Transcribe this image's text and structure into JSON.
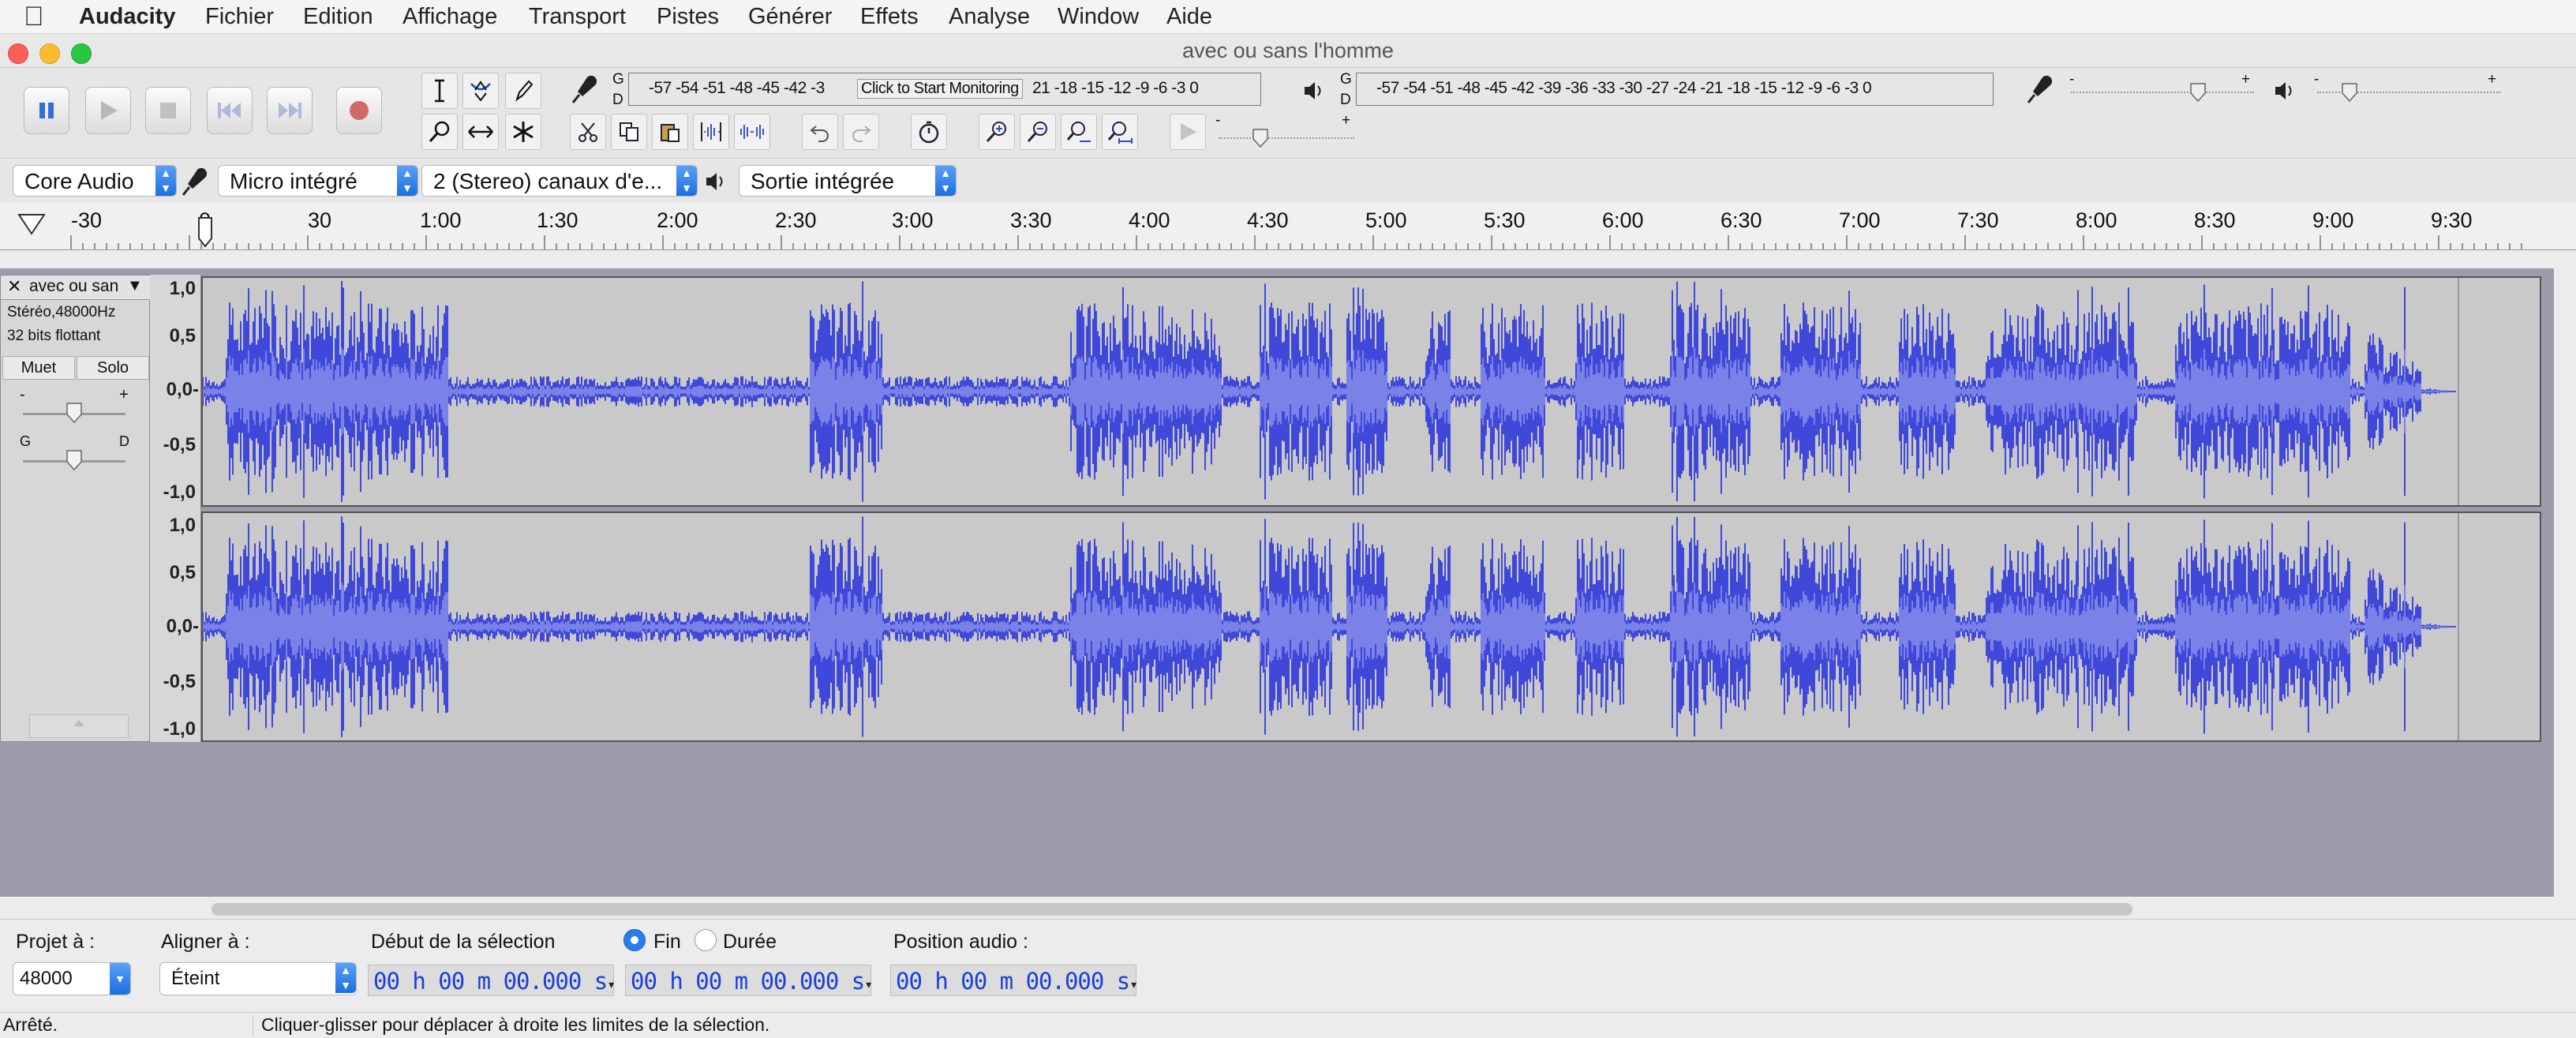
{
  "menubar": {
    "apple": "",
    "app_name": "Audacity",
    "items": [
      "Fichier",
      "Edition",
      "Affichage",
      "Transport",
      "Pistes",
      "Générer",
      "Effets",
      "Analyse",
      "Window",
      "Aide"
    ]
  },
  "window": {
    "title": "avec ou sans l'homme"
  },
  "meters": {
    "gd_g": "G",
    "gd_d": "D",
    "record_scale": "-57 -54 -51 -48 -45 -42 -3",
    "record_scale_tail": "21 -18 -15 -12 -9 -6 -3 0",
    "click_to_monitor": "Click to Start Monitoring",
    "play_scale": "-57 -54 -51 -48 -45 -42 -39 -36 -33 -30 -27 -24 -21 -18 -15 -12 -9 -6 -3 0",
    "minus": "-",
    "plus": "+"
  },
  "devices": {
    "host": "Core Audio",
    "input": "Micro intégré",
    "channels": "2 (Stereo) canaux d'e...",
    "output": "Sortie intégrée"
  },
  "ruler": {
    "labels": [
      "-30",
      "0",
      "30",
      "1:00",
      "1:30",
      "2:00",
      "2:30",
      "3:00",
      "3:30",
      "4:00",
      "4:30",
      "5:00",
      "5:30",
      "6:00",
      "6:30",
      "7:00",
      "7:30",
      "8:00",
      "8:30",
      "9:00",
      "9:30"
    ]
  },
  "track": {
    "name": "avec ou san",
    "format": "Stéréo,48000Hz",
    "bits": "32 bits flottant",
    "mute": "Muet",
    "solo": "Solo",
    "gain_minus": "-",
    "gain_plus": "+",
    "pan_left": "G",
    "pan_right": "D",
    "close": "✕",
    "menu_arrow": "▼",
    "vscale": [
      "1,0",
      "0,5",
      "0,0-",
      "-0,5",
      "-1,0"
    ]
  },
  "selection": {
    "project_rate_label": "Projet à :",
    "project_rate": "48000",
    "snap_label": "Aligner à :",
    "snap_value": "Éteint",
    "start_label": "Début de la sélection",
    "end_option": "Fin",
    "length_option": "Durée",
    "end_selected": true,
    "audio_pos_label": "Position audio :",
    "start_time": "00 h 00 m 00.000 s",
    "end_time": "00 h 00 m 00.000 s",
    "audio_time": "00 h 00 m 00.000 s"
  },
  "status": {
    "state": "Arrêté.",
    "hint": "Cliquer-glisser pour déplacer à droite les limites de la sélection."
  },
  "colors": {
    "wave": "#3f48d8",
    "wave_rms": "#7a82e8",
    "track_bg": "#9b9baa",
    "accent": "#2a7cf0"
  }
}
